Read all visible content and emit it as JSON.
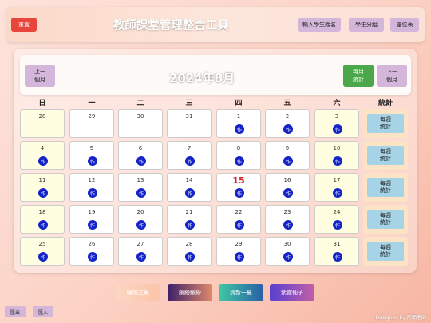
{
  "header": {
    "reset_label": "重置",
    "title": "教師課堂管理整合工具",
    "buttons": [
      "輸入學生姓名",
      "學生分組",
      "座位表"
    ]
  },
  "calendar": {
    "prev_label": "上一\n個月",
    "next_label": "下一\n個月",
    "month_stats_label": "每月\n統計",
    "month_title": "2024年8月",
    "weekdays": [
      "日",
      "一",
      "二",
      "三",
      "四",
      "五",
      "六",
      "統計"
    ],
    "weeks": [
      [
        "28",
        "29",
        "30",
        "31",
        "1",
        "2",
        "3"
      ],
      [
        "4",
        "5",
        "6",
        "7",
        "8",
        "9",
        "10"
      ],
      [
        "11",
        "12",
        "13",
        "14",
        "15",
        "16",
        "17"
      ],
      [
        "18",
        "19",
        "20",
        "21",
        "22",
        "23",
        "24"
      ],
      [
        "25",
        "26",
        "27",
        "28",
        "29",
        "30",
        "31"
      ]
    ],
    "today": "15",
    "work_badge_label": "作",
    "week_stats_label": "每週\n統計"
  },
  "themes": [
    "暖陽之夏",
    "繽紛繽紛",
    "清新一夏",
    "紫霞仙子"
  ],
  "footer": {
    "export_label": "匯出",
    "import_label": "匯入",
    "credit": "Designed by 阿簡老師"
  },
  "colors": {
    "reset": "#e8453c",
    "today": "#d8232a",
    "work_badge": "#1424c8",
    "month_stats": "#4aa84a",
    "purple_button": "#d4b6da",
    "weekend_cell": "#fffee0",
    "stat_button": "#a7d3e6"
  }
}
